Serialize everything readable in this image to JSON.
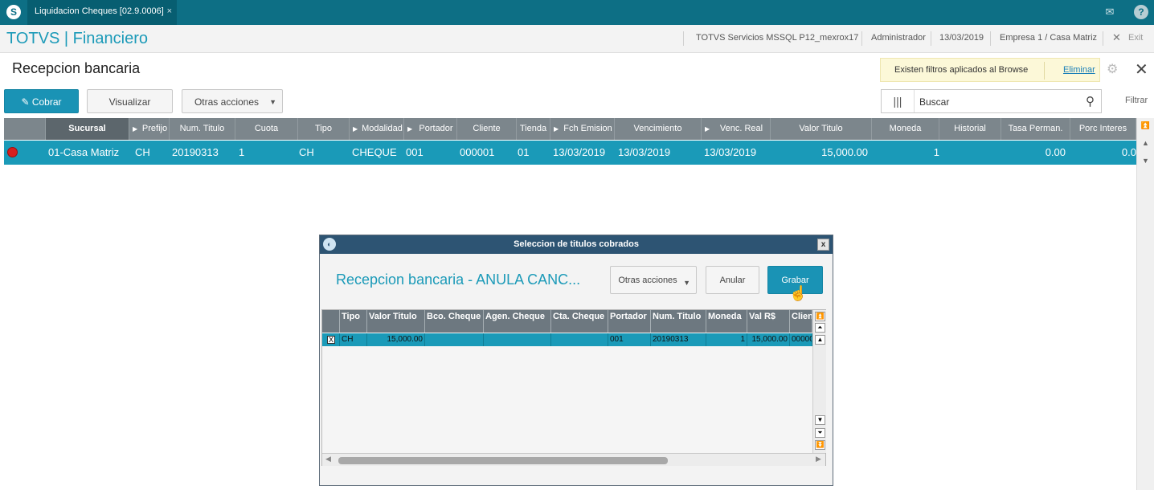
{
  "topbar": {
    "logo": "S",
    "tab_label": "Liquidacion Cheques [02.9.0006]",
    "tab_close": "×",
    "mail_icon": "✉",
    "help_icon": "?"
  },
  "header": {
    "brand": "TOTVS | Financiero",
    "server": "TOTVS Servicios MSSQL P12_mexrox17",
    "user": "Administrador",
    "date": "13/03/2019",
    "company": "Empresa 1 / Casa Matriz",
    "exit_icon": "✕",
    "exit_label": "Exit"
  },
  "page": {
    "title": "Recepcion bancaria",
    "filter_notice": "Existen filtros aplicados al Browse",
    "filter_remove": "Eliminar",
    "gear_icon": "⚙",
    "close_icon": "✕"
  },
  "toolbar": {
    "cobrar": "✎ Cobrar",
    "visualizar": "Visualizar",
    "otras_acciones": "Otras acciones",
    "caret": "▼",
    "search_placeholder": "Buscar",
    "columns_icon": "|||",
    "search_icon": "⚲",
    "filtrar": "Filtrar"
  },
  "grid": {
    "headers": [
      "Sucursal",
      "Prefijo",
      "Num. Titulo",
      "Cuota",
      "Tipo",
      "Modalidad",
      "Portador",
      "Cliente",
      "Tienda",
      "Fch Emision",
      "Vencimiento",
      "Venc. Real",
      "Valor Titulo",
      "Moneda",
      "Historial",
      "Tasa Perman.",
      "Porc Interes"
    ],
    "row": {
      "sucursal": "01-Casa Matriz",
      "prefijo": "CH",
      "num_titulo": "20190313",
      "cuota": "1",
      "tipo": "CH",
      "modalidad": "CHEQUE",
      "portador": "001",
      "cliente": "000001",
      "tienda": "01",
      "fch_emision": "13/03/2019",
      "vencimiento": "13/03/2019",
      "venc_real": "13/03/2019",
      "valor_titulo": "15,000.00",
      "moneda": "1",
      "historial": "",
      "tasa_perman": "0.00",
      "porc_interes": "0.0"
    }
  },
  "dialog": {
    "title": "Seleccion de titulos cobrados",
    "close": "x",
    "heading": "Recepcion bancaria - ANULA CANC...",
    "otras_acciones": "Otras acciones",
    "anular": "Anular",
    "grabar": "Grabar",
    "headers": [
      "Tipo",
      "Valor Titulo",
      "Bco. Cheque",
      "Agen. Cheque",
      "Cta. Cheque",
      "Portador",
      "Num. Titulo",
      "Moneda",
      "Val R$",
      "Clien"
    ],
    "row": {
      "check": "X",
      "tipo": "CH",
      "valor_titulo": "15,000.00",
      "bco_cheque": "",
      "agen_cheque": "",
      "cta_cheque": "",
      "portador": "001",
      "num_titulo": "20190313",
      "moneda": "1",
      "val_rs": "15,000.00",
      "cliente": "00000"
    }
  }
}
